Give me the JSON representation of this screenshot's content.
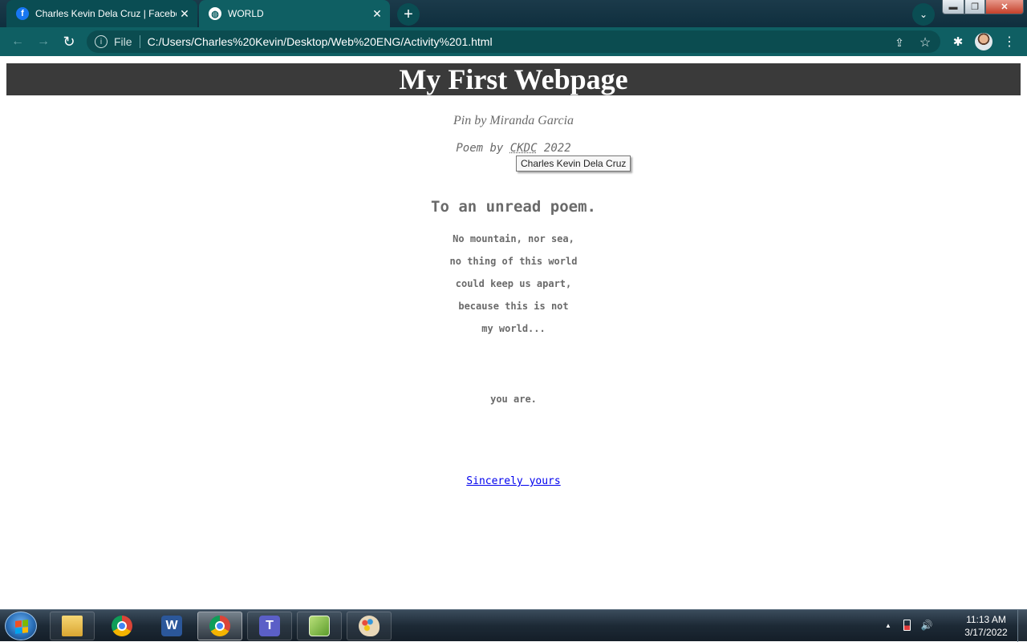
{
  "browser": {
    "tabs": [
      {
        "title": "Charles Kevin Dela Cruz | Facebook",
        "favicon": "facebook-icon",
        "active": false
      },
      {
        "title": "WORLD",
        "favicon": "globe-icon",
        "active": true
      }
    ],
    "close_glyph": "✕",
    "new_tab_glyph": "+",
    "tab_search_glyph": "⌄",
    "window_controls": {
      "minimize": "▬",
      "maximize": "❐",
      "close": "✕"
    },
    "address": {
      "scheme_label": "File",
      "url": "C:/Users/Charles%20Kevin/Desktop/Web%20ENG/Activity%201.html"
    },
    "nav_glyphs": {
      "back": "←",
      "forward": "→",
      "reload": "↻",
      "info": "i",
      "share": "⇪",
      "star": "☆",
      "extensions": "✱",
      "menu": "⋮"
    }
  },
  "page": {
    "heading": "My First Webpage",
    "pin_credit": "Pin by Miranda Garcia",
    "poem_by_prefix": "Poem by ",
    "poem_by_abbr": "CKDC",
    "poem_by_year": " 2022",
    "tooltip": "Charles Kevin Dela Cruz",
    "poem_title": "To an unread poem.",
    "lines": [
      "No mountain, nor sea,",
      "no thing of this world",
      "could keep us apart,",
      "because this is not",
      "my world...",
      "you are."
    ],
    "signature_link": "Sincerely yours"
  },
  "taskbar": {
    "apps": [
      {
        "name": "file-explorer",
        "icon": "folder-icon"
      },
      {
        "name": "chrome",
        "icon": "chrome-icon"
      },
      {
        "name": "word",
        "icon": "word-icon",
        "glyph": "W"
      },
      {
        "name": "chrome-running",
        "icon": "chrome-icon"
      },
      {
        "name": "teams",
        "icon": "teams-icon",
        "glyph": "T"
      },
      {
        "name": "notepad-plus",
        "icon": "notepad-icon"
      },
      {
        "name": "paint",
        "icon": "paint-icon"
      }
    ],
    "tray": {
      "arrow": "▲",
      "volume": "🔊"
    },
    "clock": {
      "time": "11:13 AM",
      "date": "3/17/2022"
    }
  },
  "colors": {
    "chrome_toolbar": "#0f5f63",
    "heading_bg": "#3a3a3a",
    "text_gray": "#6a6a6a",
    "link": "#0000ee"
  }
}
